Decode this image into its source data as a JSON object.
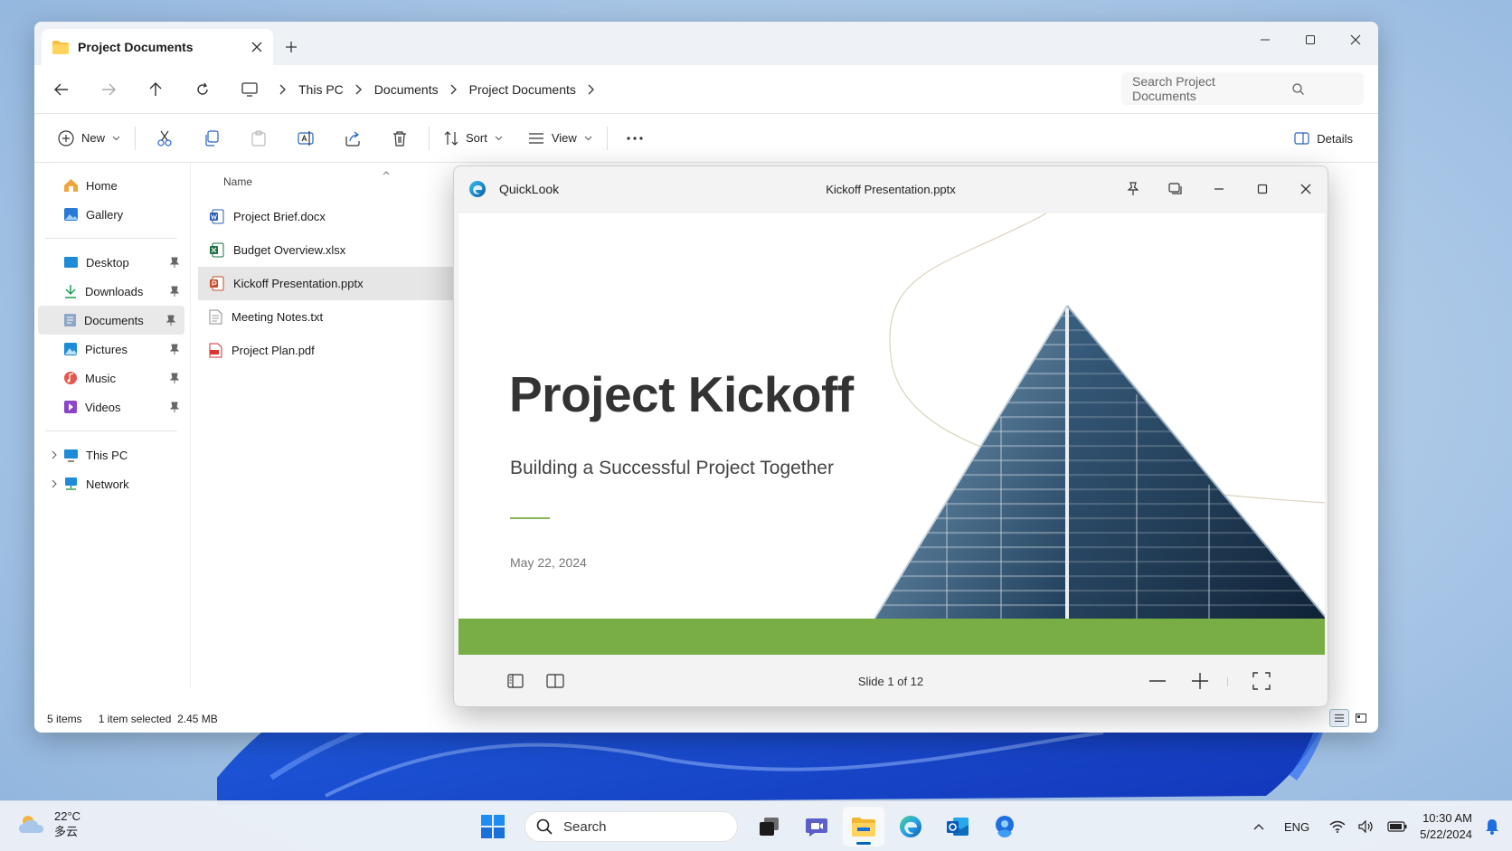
{
  "explorer": {
    "tab_title": "Project Documents",
    "breadcrumbs": [
      "This PC",
      "Documents",
      "Project Documents"
    ],
    "search_placeholder": "Search Project Documents",
    "commands": {
      "new": "New",
      "sort": "Sort",
      "view": "View",
      "details": "Details"
    },
    "sidebar": {
      "top": [
        {
          "label": "Home",
          "icon": "home-icon"
        },
        {
          "label": "Gallery",
          "icon": "gallery-icon"
        }
      ],
      "pinned": [
        {
          "label": "Desktop",
          "icon": "desktop-icon"
        },
        {
          "label": "Downloads",
          "icon": "download-icon"
        },
        {
          "label": "Documents",
          "icon": "documents-icon",
          "selected": true
        },
        {
          "label": "Pictures",
          "icon": "pictures-icon"
        },
        {
          "label": "Music",
          "icon": "music-icon"
        },
        {
          "label": "Videos",
          "icon": "videos-icon"
        }
      ],
      "bottom": [
        {
          "label": "This PC",
          "icon": "computer-icon"
        },
        {
          "label": "Network",
          "icon": "network-icon"
        }
      ]
    },
    "column_header": "Name",
    "files": [
      {
        "name": "Project Brief.docx",
        "icon": "word-icon"
      },
      {
        "name": "Budget Overview.xlsx",
        "icon": "excel-icon"
      },
      {
        "name": "Kickoff Presentation.pptx",
        "icon": "powerpoint-icon",
        "selected": true
      },
      {
        "name": "Meeting Notes.txt",
        "icon": "text-file-icon"
      },
      {
        "name": "Project Plan.pdf",
        "icon": "pdf-icon"
      }
    ],
    "status": {
      "count": "5 items",
      "selection": "1 item selected",
      "size": "2.45 MB"
    }
  },
  "quicklook": {
    "app_name": "QuickLook",
    "file_name": "Kickoff Presentation.pptx",
    "slide": {
      "title": "Project Kickoff",
      "subtitle": "Building a Successful Project Together",
      "date": "May 22, 2024",
      "accent_color": "#78ae45"
    },
    "slide_counter": "Slide 1 of 12"
  },
  "taskbar": {
    "weather": {
      "temp": "22°C",
      "condition": "多云"
    },
    "search_label": "Search",
    "language": "ENG",
    "time": "10:30 AM",
    "date": "5/22/2024"
  }
}
